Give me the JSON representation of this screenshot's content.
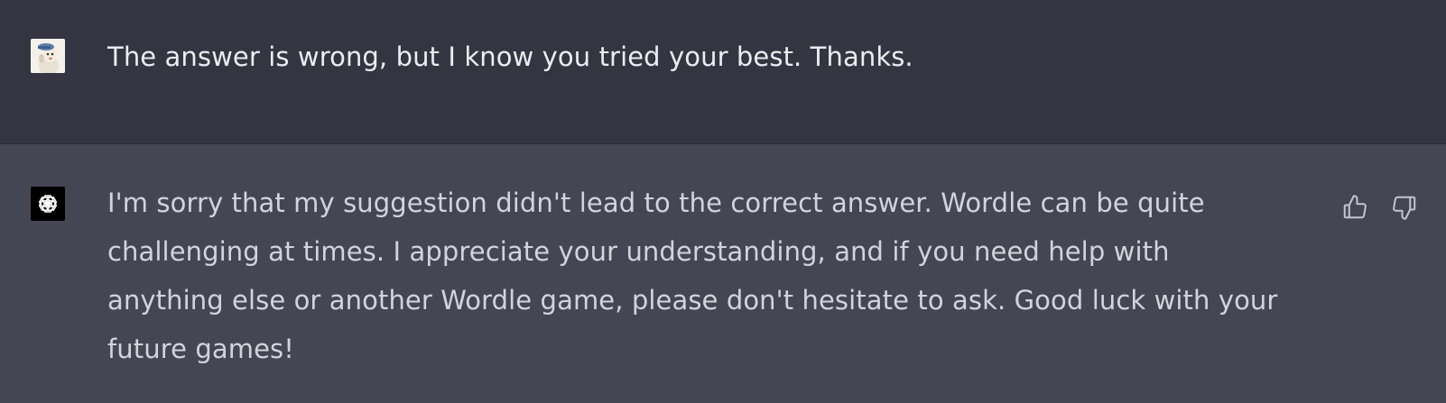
{
  "conversation": {
    "user_message": {
      "avatar": "user-avatar-icon",
      "text": "The answer is wrong, but I know you tried your best. Thanks."
    },
    "assistant_message": {
      "avatar": "openai-logo-icon",
      "text": "I'm sorry that my suggestion didn't lead to the correct answer. Wordle can be quite challenging at times. I appreciate your understanding, and if you need help with anything else or another Wordle game, please don't hesitate to ask. Good luck with your future games!",
      "actions": {
        "thumbs_up_icon": "thumbs-up-icon",
        "thumbs_down_icon": "thumbs-down-icon"
      }
    }
  },
  "colors": {
    "user_row_bg": "#343541",
    "assistant_row_bg": "#444654",
    "text": "#ececf1"
  }
}
